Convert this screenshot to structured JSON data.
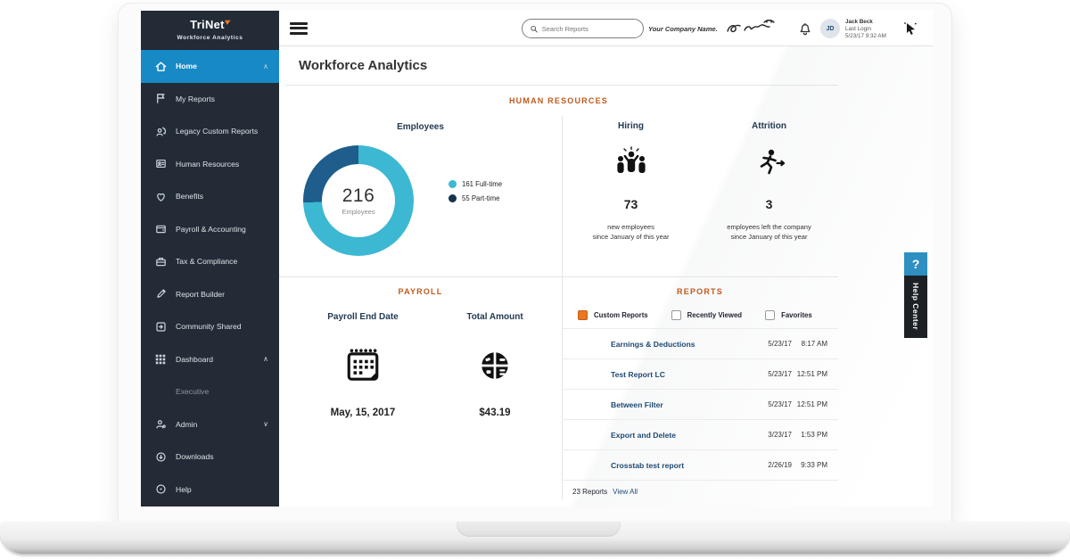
{
  "glyphs": {
    "caret_up": "∧",
    "caret_down": "∨",
    "help_q": "?"
  },
  "sidebar": {
    "brand": "TriNet",
    "brand_sub": "Workforce Analytics",
    "items": [
      {
        "label": "Home"
      },
      {
        "label": "My Reports"
      },
      {
        "label": "Legacy Custom Reports"
      },
      {
        "label": "Human Resources"
      },
      {
        "label": "Benefits"
      },
      {
        "label": "Payroll & Accounting"
      },
      {
        "label": "Tax & Compliance"
      },
      {
        "label": "Report Builder"
      },
      {
        "label": "Community Shared"
      },
      {
        "label": "Dashboard"
      },
      {
        "label": "Executive"
      },
      {
        "label": "Admin"
      },
      {
        "label": "Downloads"
      },
      {
        "label": "Help"
      }
    ]
  },
  "topbar": {
    "search_placeholder": "Search Reports",
    "company_name": "Your Company Name.",
    "user": {
      "initials": "JD",
      "name": "Jack Beck",
      "last_login_label": "Last Login",
      "last_login": "5/23/17 9:32 AM"
    }
  },
  "page_title": "Workforce Analytics",
  "sections": {
    "hr": {
      "title": "HUMAN RESOURCES",
      "employees": {
        "title": "Employees",
        "total": "216",
        "total_label": "Employees",
        "legend": [
          {
            "label": "161 Full-time",
            "color": "#3cb8d3"
          },
          {
            "label": "55 Part-time",
            "color": "#17324d"
          }
        ]
      },
      "hiring": {
        "title": "Hiring",
        "value": "73",
        "caption_line1": "new employees",
        "caption_line2": "since January of this year"
      },
      "attrition": {
        "title": "Attrition",
        "value": "3",
        "caption_line1": "employees left the company",
        "caption_line2": "since January of this year"
      }
    },
    "payroll": {
      "title": "PAYROLL",
      "end_date_label": "Payroll End Date",
      "end_date": "May, 15, 2017",
      "total_label": "Total Amount",
      "total": "$43.19"
    },
    "reports": {
      "title": "REPORTS",
      "filters": [
        {
          "label": "Custom Reports",
          "checked": true
        },
        {
          "label": "Recently Viewed",
          "checked": false
        },
        {
          "label": "Favorites",
          "checked": false
        }
      ],
      "rows": [
        {
          "name": "Earnings & Deductions",
          "date": "5/23/17",
          "time": "8:17 AM"
        },
        {
          "name": "Test Report LC",
          "date": "5/23/17",
          "time": "12:51 PM"
        },
        {
          "name": "Between Filter",
          "date": "5/23/17",
          "time": "12:51 PM"
        },
        {
          "name": "Export and Delete",
          "date": "3/23/17",
          "time": "1:53 PM"
        },
        {
          "name": "Crosstab test report",
          "date": "2/26/19",
          "time": "9:33 PM"
        }
      ],
      "footer_count": "23 Reports",
      "footer_link": "View All"
    }
  },
  "help_tab": {
    "label": "Help Center"
  }
}
